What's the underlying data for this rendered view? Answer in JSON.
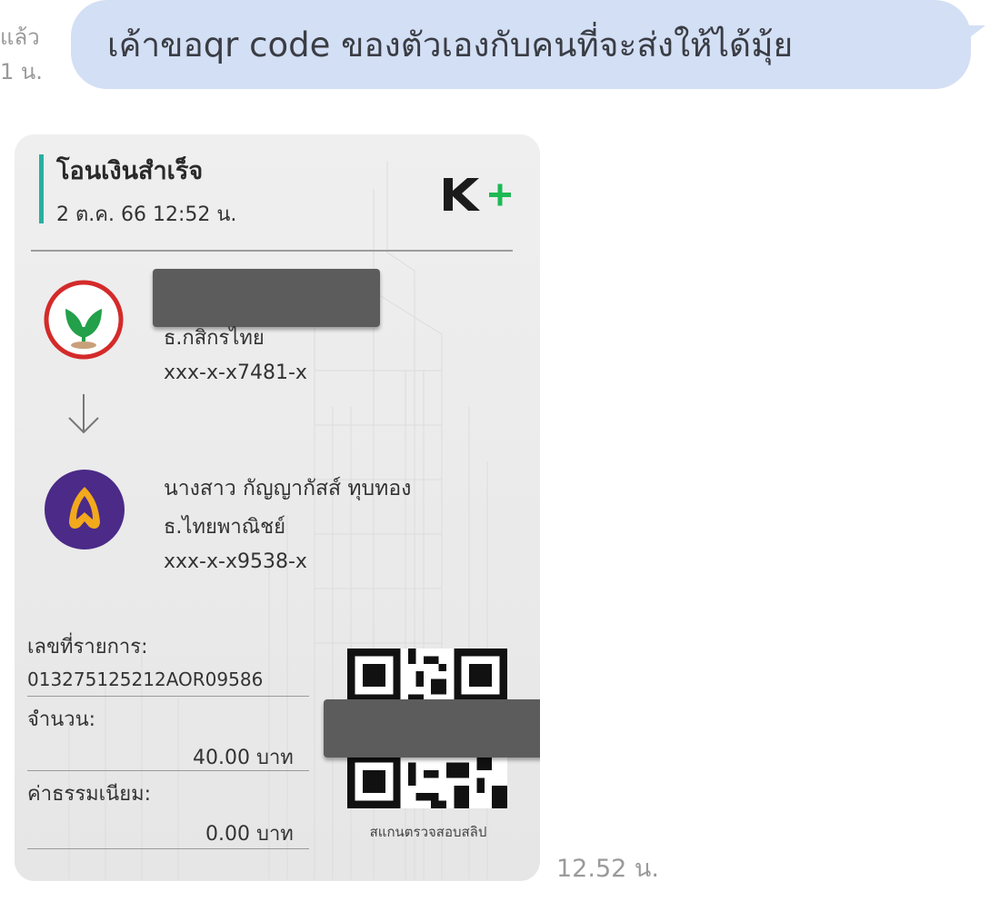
{
  "message": {
    "read_status": "แล้ว 1 น.",
    "text": "เค้าขอqr code ของตัวเองกับคนที่จะส่งให้ได้มุ้ย",
    "bubble_color": "#d3dff4",
    "timestamp": "12.52 น."
  },
  "slip": {
    "title": "โอนเงินสำเร็จ",
    "datetime": "2 ต.ค. 66  12:52 น.",
    "brand": "K+",
    "accent_color": "#27b0a0",
    "sender": {
      "logo_icon": "kbank-leaf-icon",
      "bank": "ธ.กสิกรไทย",
      "account": "xxx-x-x7481-x"
    },
    "receiver": {
      "logo_icon": "scb-icon",
      "name": "นางสาว กัญญากัสส์ ทุบทอง",
      "bank": "ธ.ไทยพาณิชย์",
      "account": "xxx-x-x9538-x"
    },
    "reference_label": "เลขที่รายการ:",
    "reference_value": "013275125212AOR09586",
    "amount_label": "จำนวน:",
    "amount_value": "40.00 บาท",
    "fee_label": "ค่าธรรมเนียม:",
    "fee_value": "0.00 บาท",
    "qr_caption": "สแกนตรวจสอบสลิป"
  }
}
